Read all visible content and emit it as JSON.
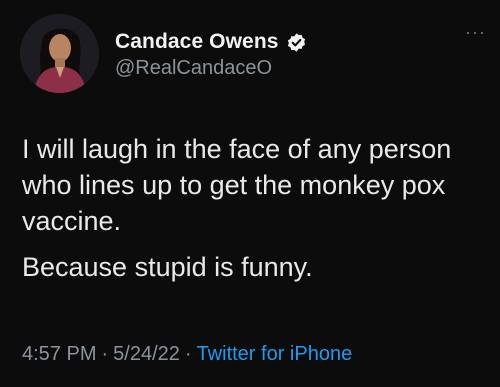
{
  "author": {
    "display_name": "Candace Owens",
    "handle": "@RealCandaceO",
    "verified_icon": "verified-badge-icon"
  },
  "more_icon": "ellipsis-icon",
  "tweet": {
    "line1": "I will laugh in the face of any person who lines up to get the monkey pox vaccine.",
    "line2": "Because stupid is funny."
  },
  "meta": {
    "time": "4:57 PM",
    "separator": "·",
    "date": "5/24/22",
    "source": "Twitter for iPhone"
  },
  "colors": {
    "background": "#0c0c0d",
    "text": "#e7e9ea",
    "secondary": "#8b949c",
    "link": "#1d9bf0"
  }
}
